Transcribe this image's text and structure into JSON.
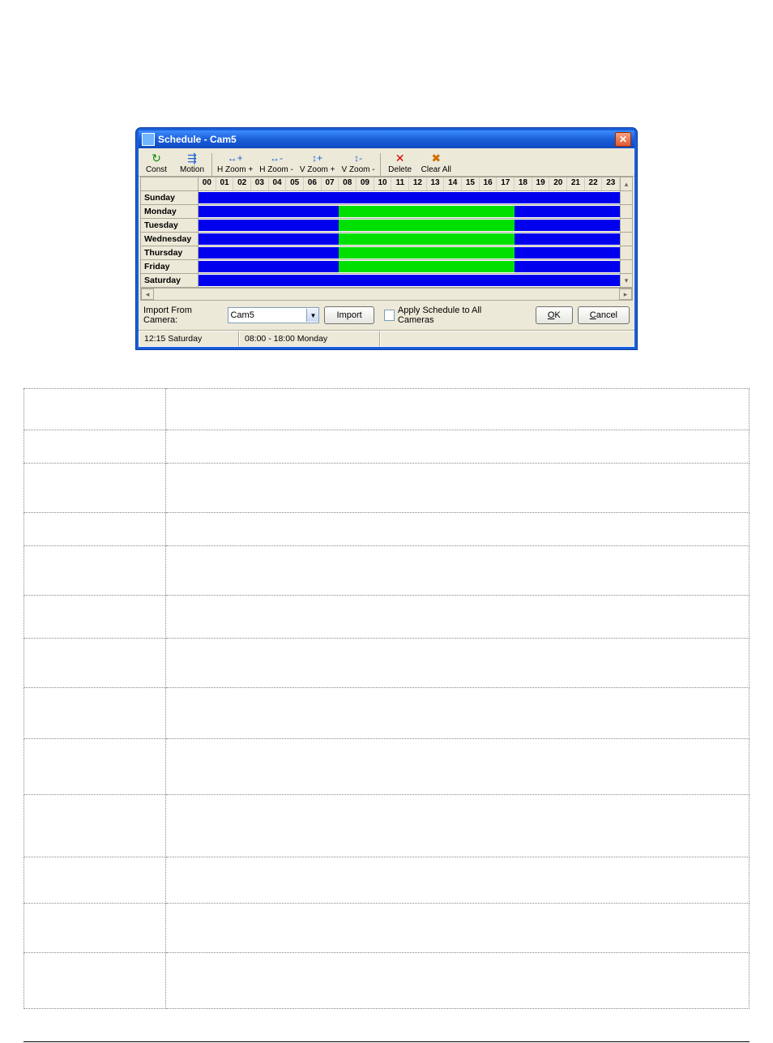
{
  "window": {
    "title": "Schedule - Cam5",
    "close_glyph": "✕"
  },
  "toolbar": [
    {
      "key": "const",
      "label": "Const",
      "icon": "↻",
      "cls": "ic-refresh"
    },
    {
      "key": "motion",
      "label": "Motion",
      "icon": "⇶",
      "cls": "ic-motion"
    },
    {
      "sep": true
    },
    {
      "key": "hzoomp",
      "label": "H Zoom +",
      "icon": "↔+",
      "cls": "ic-zoom"
    },
    {
      "key": "hzoomm",
      "label": "H Zoom -",
      "icon": "↔-",
      "cls": "ic-zoom"
    },
    {
      "key": "vzoomp",
      "label": "V Zoom +",
      "icon": "↕+",
      "cls": "ic-zoom"
    },
    {
      "key": "vzoomm",
      "label": "V Zoom -",
      "icon": "↕-",
      "cls": "ic-zoom"
    },
    {
      "sep": true
    },
    {
      "key": "delete",
      "label": "Delete",
      "icon": "✕",
      "cls": "ic-del"
    },
    {
      "key": "clearall",
      "label": "Clear All",
      "icon": "✖",
      "cls": "ic-clr"
    }
  ],
  "hours": [
    "00",
    "01",
    "02",
    "03",
    "04",
    "05",
    "06",
    "07",
    "08",
    "09",
    "10",
    "11",
    "12",
    "13",
    "14",
    "15",
    "16",
    "17",
    "18",
    "19",
    "20",
    "21",
    "22",
    "23"
  ],
  "days": [
    {
      "name": "Sunday",
      "segments": [
        {
          "type": "const",
          "start": 0,
          "end": 24
        }
      ]
    },
    {
      "name": "Monday",
      "segments": [
        {
          "type": "const",
          "start": 0,
          "end": 8
        },
        {
          "type": "motion",
          "start": 8,
          "end": 18
        },
        {
          "type": "const",
          "start": 18,
          "end": 24
        }
      ]
    },
    {
      "name": "Tuesday",
      "segments": [
        {
          "type": "const",
          "start": 0,
          "end": 8
        },
        {
          "type": "motion",
          "start": 8,
          "end": 18
        },
        {
          "type": "const",
          "start": 18,
          "end": 24
        }
      ]
    },
    {
      "name": "Wednesday",
      "segments": [
        {
          "type": "const",
          "start": 0,
          "end": 8
        },
        {
          "type": "motion",
          "start": 8,
          "end": 18
        },
        {
          "type": "const",
          "start": 18,
          "end": 24
        }
      ]
    },
    {
      "name": "Thursday",
      "segments": [
        {
          "type": "const",
          "start": 0,
          "end": 8
        },
        {
          "type": "motion",
          "start": 8,
          "end": 18
        },
        {
          "type": "const",
          "start": 18,
          "end": 24
        }
      ]
    },
    {
      "name": "Friday",
      "segments": [
        {
          "type": "const",
          "start": 0,
          "end": 8
        },
        {
          "type": "motion",
          "start": 8,
          "end": 18
        },
        {
          "type": "const",
          "start": 18,
          "end": 24
        }
      ]
    },
    {
      "name": "Saturday",
      "segments": [
        {
          "type": "const",
          "start": 0,
          "end": 24
        }
      ]
    }
  ],
  "bottom": {
    "import_label": "Import From Camera:",
    "camera_value": "Cam5",
    "import_btn": "Import",
    "apply_label": "Apply Schedule to All Cameras",
    "ok_btn": "OK",
    "cancel_btn": "Cancel"
  },
  "status": {
    "left": "12:15  Saturday",
    "right": "08:00 - 18:00  Monday"
  },
  "desc_rows": [
    {
      "k": "",
      "v": ""
    },
    {
      "k": "",
      "v": ""
    },
    {
      "k": "",
      "v": ""
    },
    {
      "k": "",
      "v": ""
    },
    {
      "k": "",
      "v": ""
    },
    {
      "k": "",
      "v": ""
    },
    {
      "k": "",
      "v": ""
    },
    {
      "k": "",
      "v": ""
    },
    {
      "k": "",
      "v": ""
    },
    {
      "k": "",
      "v": ""
    },
    {
      "k": "",
      "v": ""
    },
    {
      "k": "",
      "v": ""
    },
    {
      "k": "",
      "v": ""
    }
  ]
}
